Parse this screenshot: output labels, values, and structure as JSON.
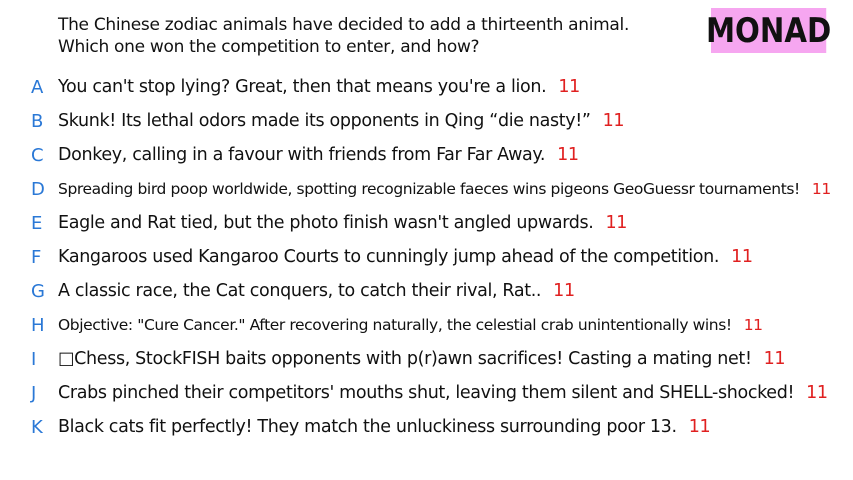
{
  "prompt": {
    "line1": "The Chinese zodiac animals have decided to add a thirteenth animal.",
    "line2": "Which one won the competition to enter, and how?"
  },
  "brand": "MONAD",
  "colors": {
    "letter": "#2a78d6",
    "count": "#e02020",
    "brand_bg": "#f6a6f0"
  },
  "options": [
    {
      "letter": "A",
      "text": "You can't stop lying? Great, then that means you're a lion.",
      "count": "11"
    },
    {
      "letter": "B",
      "text": "Skunk! Its lethal odors made its opponents in Qing “die nasty!”",
      "count": "11"
    },
    {
      "letter": "C",
      "text": "Donkey, calling in a favour with friends from Far Far Away.",
      "count": "11"
    },
    {
      "letter": "D",
      "text": "Spreading bird poop worldwide, spotting recognizable faeces wins pigeons GeoGuessr tournaments!",
      "count": "11"
    },
    {
      "letter": "E",
      "text": "Eagle and Rat tied, but the photo finish wasn't angled upwards.",
      "count": "11"
    },
    {
      "letter": "F",
      "text": "Kangaroos used Kangaroo Courts to cunningly jump ahead of the competition.",
      "count": "11"
    },
    {
      "letter": "G",
      "text": "A classic race, the Cat conquers, to catch their rival, Rat..",
      "count": "11"
    },
    {
      "letter": "H",
      "text": "Objective: \"Cure Cancer.\" After recovering naturally, the celestial crab unintentionally wins!",
      "count": "11"
    },
    {
      "letter": "I",
      "text": "□Chess, StockFISH baits opponents with p(r)awn sacrifices! Casting a mating net!",
      "count": "11"
    },
    {
      "letter": "J",
      "text": "Crabs pinched their competitors' mouths shut, leaving them silent and SHELL-shocked!",
      "count": "11"
    },
    {
      "letter": "K",
      "text": "Black cats fit perfectly! They match the unluckiness surrounding poor 13.",
      "count": "11"
    }
  ]
}
